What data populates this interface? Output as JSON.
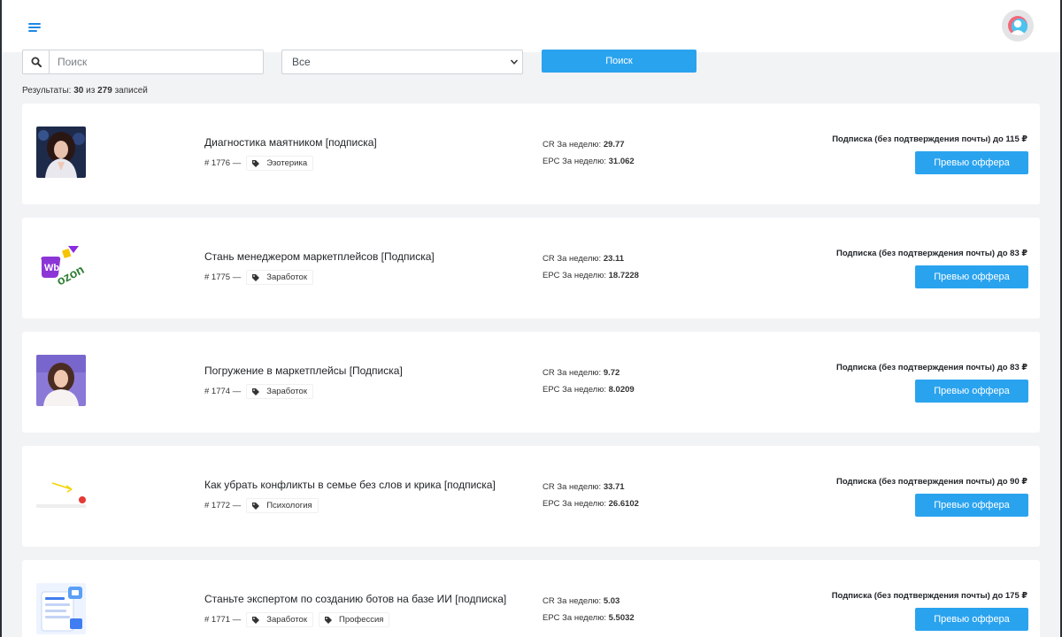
{
  "header": {
    "menu_icon": "hamburger-menu-icon",
    "avatar_icon": "user-avatar-icon"
  },
  "filters": {
    "search_placeholder": "Поиск",
    "search_icon": "search-icon",
    "category_selected": "Все",
    "search_button": "Поиск"
  },
  "results": {
    "prefix": "Результаты:",
    "shown": "30",
    "of": "из",
    "total": "279",
    "suffix": "записей"
  },
  "labels": {
    "cr": "CR За неделю:",
    "epc": "EPC За неделю:",
    "preview": "Превью оффера",
    "dash": "—"
  },
  "offers": [
    {
      "title": "Диагностика маятником [подписка]",
      "id": "# 1776",
      "tags": [
        "Эзотерика"
      ],
      "cr": "29.77",
      "epc": "31.062",
      "payout": "Подписка (без подтверждения почты) до 115 ₽"
    },
    {
      "title": "Стань менеджером маркетплейсов [Подписка]",
      "id": "# 1775",
      "tags": [
        "Заработок"
      ],
      "cr": "23.11",
      "epc": "18.7228",
      "payout": "Подписка (без подтверждения почты) до 83 ₽",
      "logo_text_1": "Wb",
      "logo_text_2": "ozon"
    },
    {
      "title": "Погружение в маркетплейсы [Подписка]",
      "id": "# 1774",
      "tags": [
        "Заработок"
      ],
      "cr": "9.72",
      "epc": "8.0209",
      "payout": "Подписка (без подтверждения почты) до 83 ₽"
    },
    {
      "title": "Как убрать конфликты в семье без слов и крика [подписка]",
      "id": "# 1772",
      "tags": [
        "Психология"
      ],
      "cr": "33.71",
      "epc": "26.6102",
      "payout": "Подписка (без подтверждения почты) до 90 ₽"
    },
    {
      "title": "Станьте экспертом по созданию ботов на базе ИИ [подписка]",
      "id": "# 1771",
      "tags": [
        "Заработок",
        "Профессия"
      ],
      "cr": "5.03",
      "epc": "5.5032",
      "payout": "Подписка (без подтверждения почты) до 175 ₽"
    }
  ]
}
